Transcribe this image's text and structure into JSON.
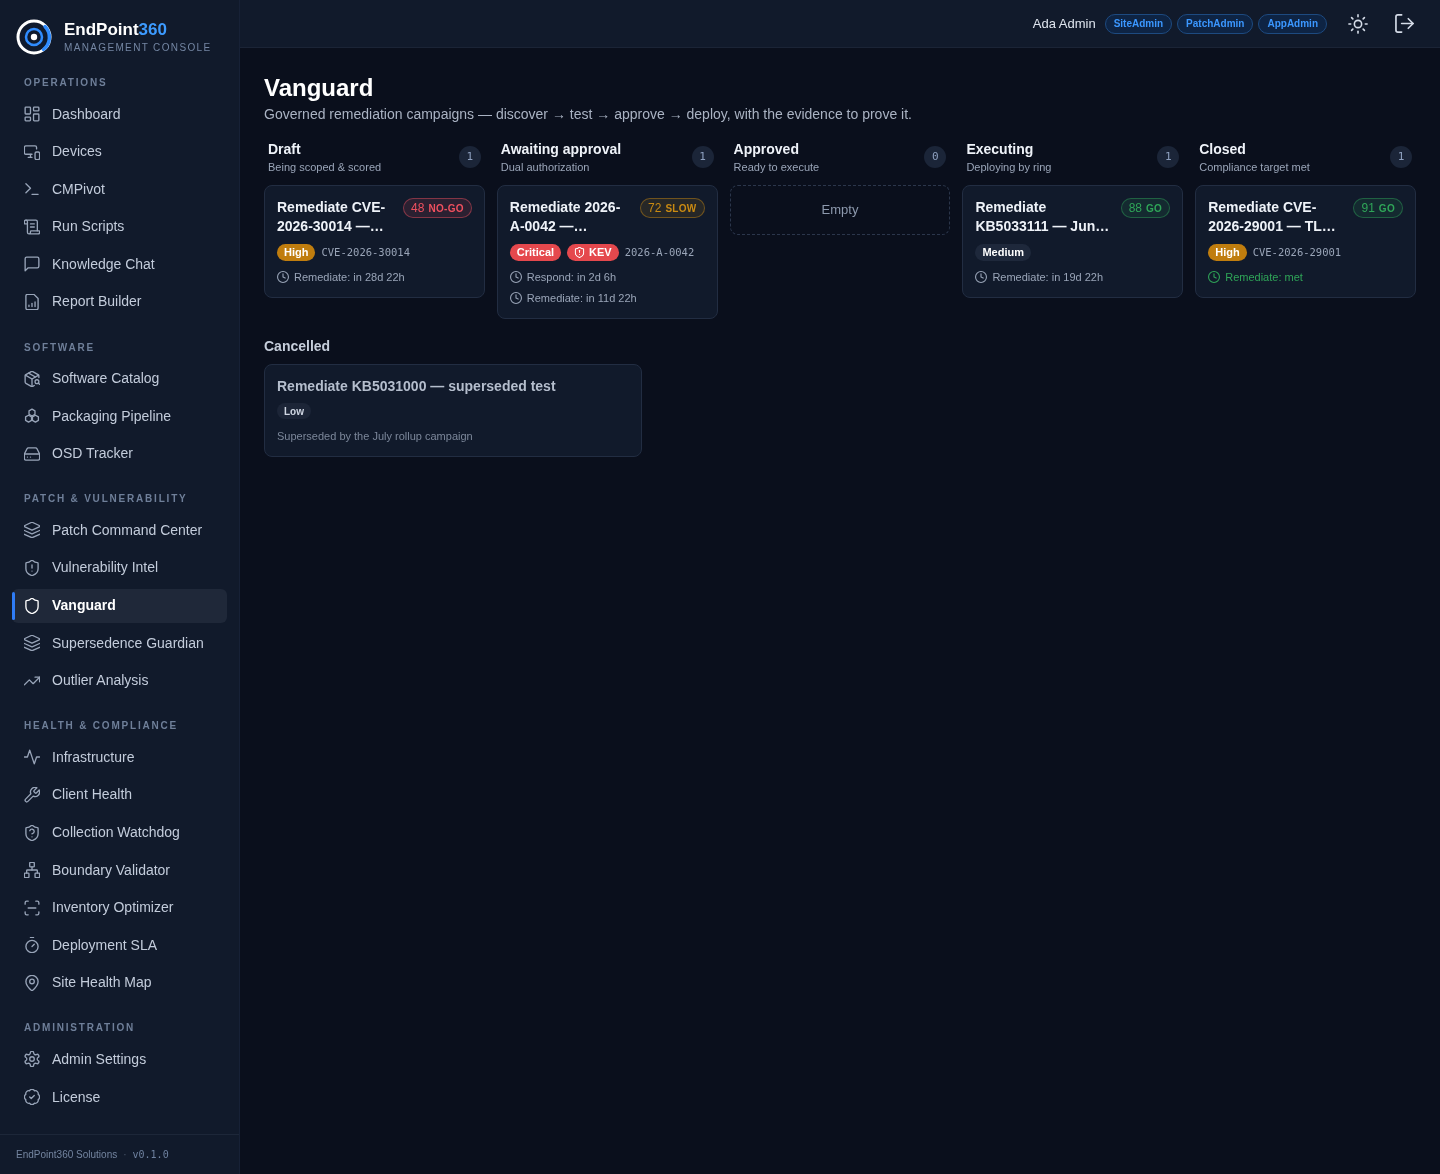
{
  "sidebar": {
    "brand": {
      "name": "EndPoint",
      "accent": "360",
      "tagline": "MANAGEMENT CONSOLE"
    },
    "sections": [
      {
        "label": "OPERATIONS",
        "items": [
          {
            "label": "Dashboard",
            "selected": false
          },
          {
            "label": "Devices",
            "selected": false
          },
          {
            "label": "CMPivot",
            "selected": false
          },
          {
            "label": "Run Scripts",
            "selected": false
          },
          {
            "label": "Knowledge Chat",
            "selected": false
          },
          {
            "label": "Report Builder",
            "selected": false
          }
        ]
      },
      {
        "label": "SOFTWARE",
        "items": [
          {
            "label": "Software Catalog",
            "selected": false
          },
          {
            "label": "Packaging Pipeline",
            "selected": false
          },
          {
            "label": "OSD Tracker",
            "selected": false
          }
        ]
      },
      {
        "label": "PATCH & VULNERABILITY",
        "items": [
          {
            "label": "Patch Command Center",
            "selected": false
          },
          {
            "label": "Vulnerability Intel",
            "selected": false
          },
          {
            "label": "Vanguard",
            "selected": true
          },
          {
            "label": "Supersedence Guardian",
            "selected": false
          },
          {
            "label": "Outlier Analysis",
            "selected": false
          }
        ]
      },
      {
        "label": "HEALTH & COMPLIANCE",
        "items": [
          {
            "label": "Infrastructure",
            "selected": false
          },
          {
            "label": "Client Health",
            "selected": false
          },
          {
            "label": "Collection Watchdog",
            "selected": false
          },
          {
            "label": "Boundary Validator",
            "selected": false
          },
          {
            "label": "Inventory Optimizer",
            "selected": false
          },
          {
            "label": "Deployment SLA",
            "selected": false
          },
          {
            "label": "Site Health Map",
            "selected": false
          }
        ]
      },
      {
        "label": "ADMINISTRATION",
        "items": [
          {
            "label": "Admin Settings",
            "selected": false
          },
          {
            "label": "License",
            "selected": false
          }
        ]
      }
    ],
    "footer": {
      "company": "EndPoint360 Solutions",
      "separator": "·",
      "version": "v0.1.0"
    }
  },
  "header": {
    "user": "Ada Admin",
    "roles": [
      "SiteAdmin",
      "PatchAdmin",
      "AppAdmin"
    ]
  },
  "page": {
    "title": "Vanguard",
    "subtitle": "Governed remediation campaigns — discover → test → approve → deploy, with the evidence to prove it."
  },
  "board": {
    "columns": [
      {
        "title": "Draft",
        "subtitle": "Being scoped & scored",
        "count": "1",
        "cards": [
          {
            "title": "Remediate CVE-2026-30014 —…",
            "score": {
              "value": "48",
              "label": "NO-GO",
              "kind": "no-go"
            },
            "severity": {
              "text": "High",
              "color": "#c07d0e"
            },
            "reference": "CVE-2026-30014",
            "timers": [
              {
                "text": "Remediate: in 28d 22h",
                "met": false
              }
            ]
          }
        ]
      },
      {
        "title": "Awaiting approval",
        "subtitle": "Dual authorization",
        "count": "1",
        "cards": [
          {
            "title": "Remediate 2026-A-0042 —…",
            "score": {
              "value": "72",
              "label": "SLOW",
              "kind": "slow"
            },
            "severity": {
              "text": "Critical",
              "color": "#e5484d"
            },
            "kev": "KEV",
            "reference": "2026-A-0042",
            "timers": [
              {
                "text": "Respond: in 2d 6h",
                "met": false
              },
              {
                "text": "Remediate: in 11d 22h",
                "met": false
              }
            ]
          }
        ]
      },
      {
        "title": "Approved",
        "subtitle": "Ready to execute",
        "count": "0",
        "empty_text": "Empty"
      },
      {
        "title": "Executing",
        "subtitle": "Deploying by ring",
        "count": "1",
        "cards": [
          {
            "title": "Remediate KB5033111 — Jun…",
            "score": {
              "value": "88",
              "label": "GO",
              "kind": "go"
            },
            "severity": {
              "text": "Medium",
              "color": "#1e283b"
            },
            "timers": [
              {
                "text": "Remediate: in 19d 22h",
                "met": false
              }
            ]
          }
        ]
      },
      {
        "title": "Closed",
        "subtitle": "Compliance target met",
        "count": "1",
        "cards": [
          {
            "title": "Remediate CVE-2026-29001 — TL…",
            "score": {
              "value": "91",
              "label": "GO",
              "kind": "go"
            },
            "severity": {
              "text": "High",
              "color": "#c07d0e"
            },
            "reference": "CVE-2026-29001",
            "timers": [
              {
                "text": "Remediate: met",
                "met": true
              }
            ]
          }
        ]
      }
    ]
  },
  "cancelled": {
    "title": "Cancelled",
    "cards": [
      {
        "title": "Remediate KB5031000 — superseded test",
        "severity": {
          "text": "Low",
          "color": "#1c2537"
        },
        "note": "Superseded by the July rollup campaign"
      }
    ]
  }
}
